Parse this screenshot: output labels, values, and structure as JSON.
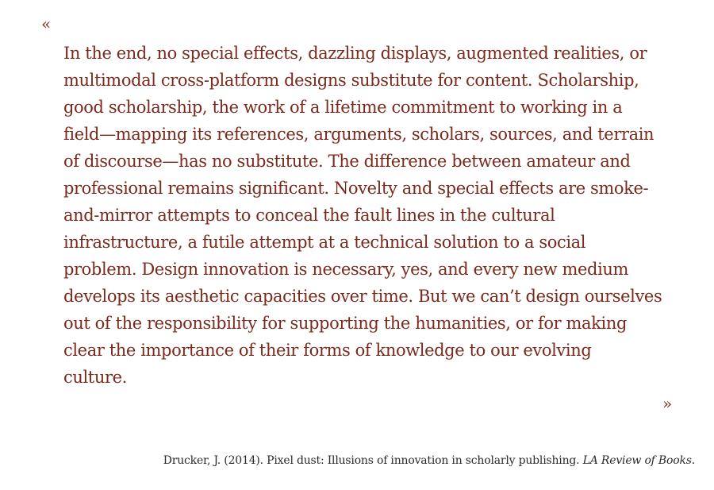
{
  "quote": {
    "open_mark": "«",
    "close_mark": "»",
    "lines": [
      "In the end, no special effects, dazzling displays, augmented realities, or",
      "multimodal cross-platform designs substitute for content. Scholarship,",
      "good scholarship, the work of a lifetime commitment to working in a",
      "field—mapping its references, arguments, scholars, sources, and terrain",
      "of discourse—has no substitute. The difference between amateur and",
      "professional remains significant. Novelty and special effects are smoke-",
      "and-mirror attempts to conceal the fault lines in the cultural",
      "infrastructure, a futile attempt at a technical solution to a social",
      "problem. Design innovation is necessary, yes, and every new medium",
      "develops its aesthetic capacities over time. But we can’t design ourselves",
      "out of the responsibility for supporting the humanities, or for making",
      "clear the importance of their forms of knowledge to our evolving",
      "culture."
    ]
  },
  "citation": {
    "text": "Drucker, J. (2014). Pixel dust: Illusions of innovation in scholarly publishing. ",
    "journal": "LA Review of Books",
    "end": "."
  }
}
